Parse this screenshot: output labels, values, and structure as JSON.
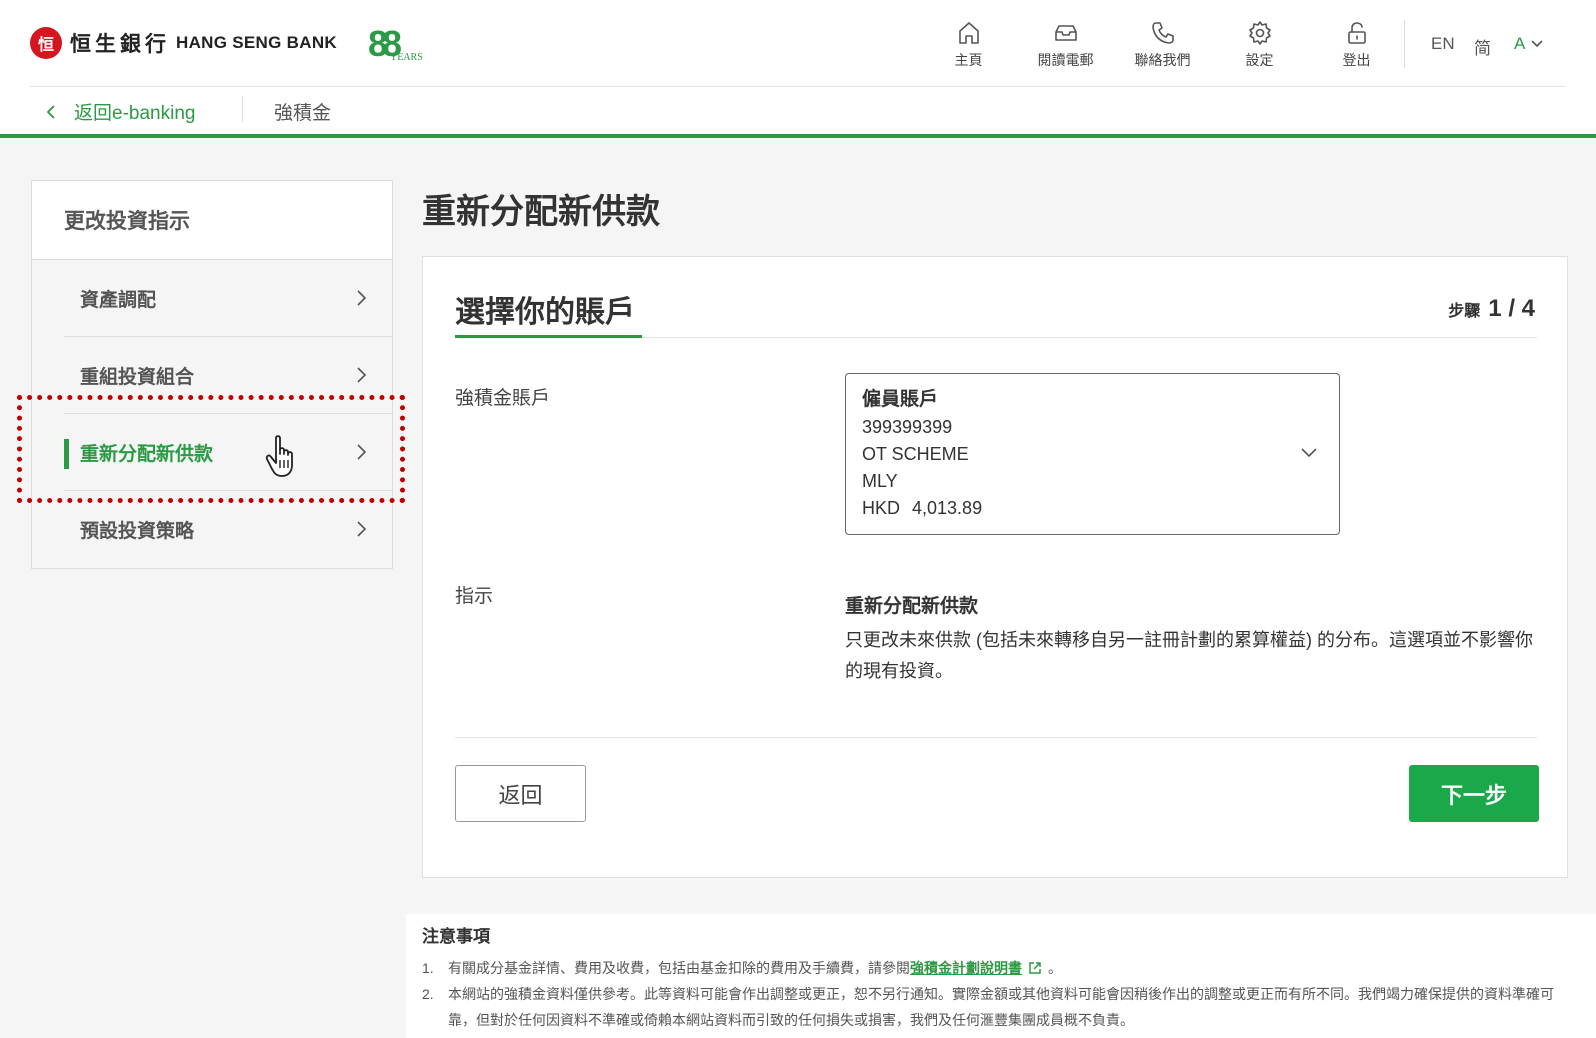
{
  "brand": {
    "logo_cn": "恒生銀行",
    "logo_en": "HANG SENG BANK",
    "anniversary_num": "88",
    "anniversary_text": "YEARS",
    "accent": "#2b9a45",
    "primary_button": "#1ba84a",
    "logo_red": "#d4171e",
    "highlight_color": "#c00000"
  },
  "topnav": {
    "items": [
      {
        "label": "主頁",
        "icon": "home-icon"
      },
      {
        "label": "閱讀電郵",
        "icon": "inbox-icon"
      },
      {
        "label": "聯絡我們",
        "icon": "phone-icon"
      },
      {
        "label": "設定",
        "icon": "gear-icon"
      },
      {
        "label": "登出",
        "icon": "lock-icon"
      }
    ],
    "lang_en": "EN",
    "lang_sc": "简",
    "font_size": "A"
  },
  "breadcrumb": {
    "back": "返回e-banking",
    "current": "強積金"
  },
  "sidebar": {
    "heading": "更改投資指示",
    "items": [
      {
        "label": "資產調配"
      },
      {
        "label": "重組投資組合"
      },
      {
        "label": "重新分配新供款"
      },
      {
        "label": "預設投資策略"
      }
    ],
    "active_index": 2
  },
  "page": {
    "title": "重新分配新供款"
  },
  "card": {
    "title": "選擇你的賬戶",
    "step_label": "步驟",
    "step_value": "1 / 4",
    "account_label": "強積金賬戶",
    "account": {
      "type": "僱員賬戶",
      "number": "399399399",
      "scheme": "OT SCHEME",
      "name": "MLY",
      "currency": "HKD",
      "balance": "4,013.89"
    },
    "instruction_label": "指示",
    "instruction_title": "重新分配新供款",
    "instruction_body": "只更改未來供款 (包括未來轉移自另一註冊計劃的累算權益) 的分布。這選項並不影響你的現有投資。",
    "back_button": "返回",
    "next_button": "下一步"
  },
  "notes": {
    "title": "注意事項",
    "items": [
      {
        "num": "1.",
        "before": "有關成分基金詳情、費用及收費，包括由基金扣除的費用及手續費，請參閱",
        "link": "強積金計劃說明書",
        "after": "。"
      },
      {
        "num": "2.",
        "text": "本網站的強積金資料僅供參考。此等資料可能會作出調整或更正，恕不另行通知。實際金額或其他資料可能會因稍後作出的調整或更正而有所不同。我們竭力確保提供的資料準確可靠，但對於任何因資料不準確或倚賴本網站資料而引致的任何損失或損害，我們及任何滙豐集團成員概不負責。"
      }
    ]
  }
}
